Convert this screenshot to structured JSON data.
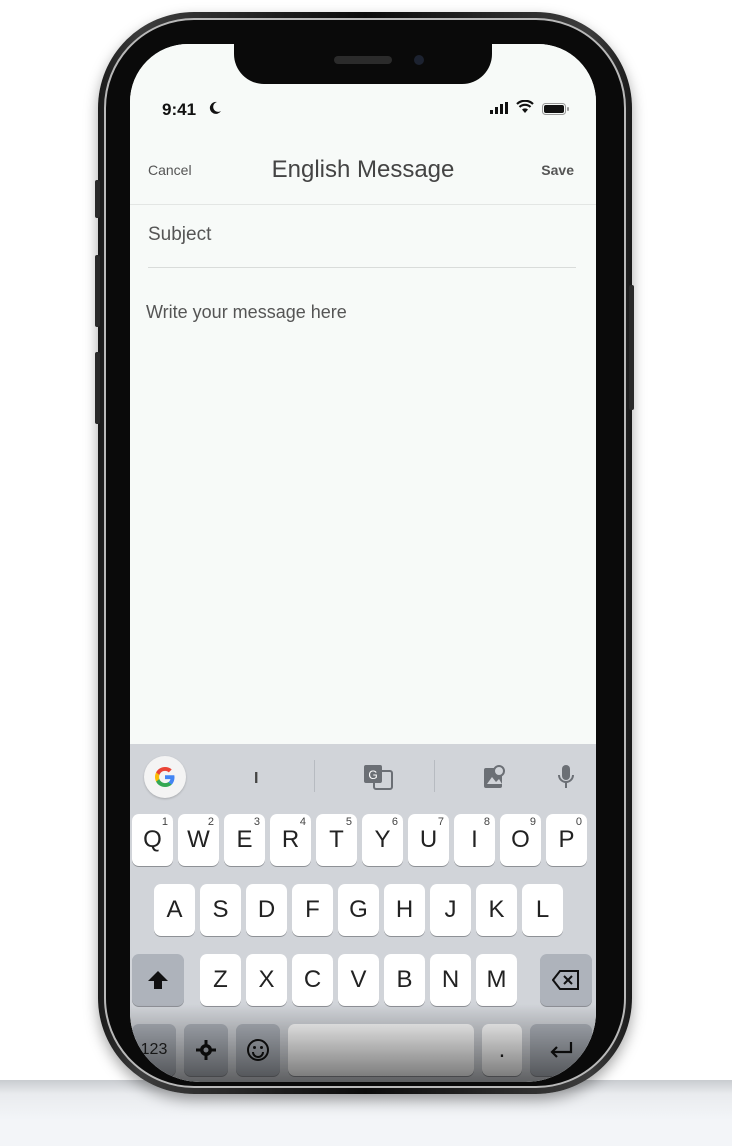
{
  "status_bar": {
    "time": "9:41"
  },
  "nav": {
    "cancel": "Cancel",
    "title": "English Message",
    "save": "Save"
  },
  "form": {
    "subject_placeholder": "Subject",
    "message_placeholder": "Write your message here"
  },
  "keyboard": {
    "toolbar": {
      "cursor_glyph": "I"
    },
    "row1": [
      {
        "label": "Q",
        "hint": "1"
      },
      {
        "label": "W",
        "hint": "2"
      },
      {
        "label": "E",
        "hint": "3"
      },
      {
        "label": "R",
        "hint": "4"
      },
      {
        "label": "T",
        "hint": "5"
      },
      {
        "label": "Y",
        "hint": "6"
      },
      {
        "label": "U",
        "hint": "7"
      },
      {
        "label": "I",
        "hint": "8"
      },
      {
        "label": "O",
        "hint": "9"
      },
      {
        "label": "P",
        "hint": "0"
      }
    ],
    "row2": [
      "A",
      "S",
      "D",
      "F",
      "G",
      "H",
      "J",
      "K",
      "L"
    ],
    "row3": [
      "Z",
      "X",
      "C",
      "V",
      "B",
      "N",
      "M"
    ],
    "bottom": {
      "numbers": "123",
      "period": "."
    }
  },
  "colors": {
    "screen_bg": "#f7faf8",
    "keyboard_bg": "#d1d4d9",
    "key_bg": "#ffffff",
    "text_gray": "#555555"
  }
}
